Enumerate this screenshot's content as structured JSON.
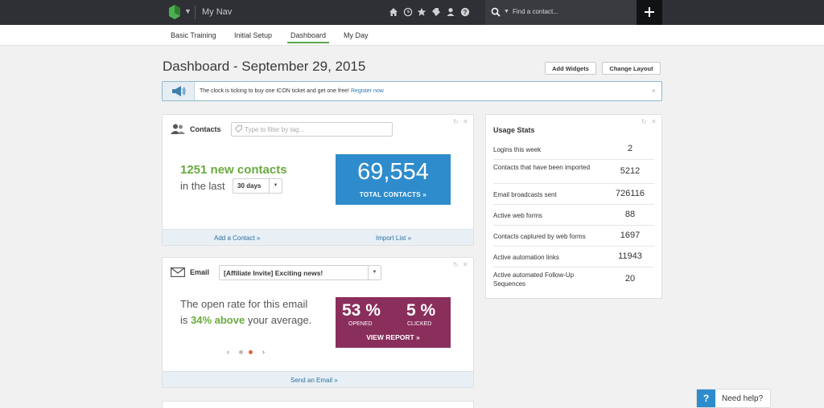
{
  "topbar": {
    "nav_title": "My Nav",
    "icons": [
      "logo-icon",
      "home-icon",
      "clock-icon",
      "star-icon",
      "tags-icon",
      "user-icon",
      "help-icon"
    ],
    "search_placeholder": "Find a contact...",
    "add_symbol": "+"
  },
  "tabs": [
    {
      "label": "Basic Training"
    },
    {
      "label": "Initial Setup"
    },
    {
      "label": "Dashboard",
      "active": true
    },
    {
      "label": "My Day"
    }
  ],
  "header": {
    "title": "Dashboard - September 29, 2015",
    "add_widgets": "Add Widgets",
    "change_layout": "Change Layout"
  },
  "banner": {
    "text": "The clock is ticking to buy one ICON ticket and get one free!",
    "link": "Register now",
    "close": "×"
  },
  "contacts_widget": {
    "title": "Contacts",
    "filter_placeholder": "Type to filter by tag...",
    "new_count_text": "1251 new contacts",
    "in_the_last": "in the last",
    "period": "30 days",
    "total": "69,554",
    "total_label": "TOTAL CONTACTS »",
    "footer_left": "Add a Contact »",
    "footer_right": "Import List »"
  },
  "email_widget": {
    "title": "Email",
    "selected_email": "[Affiliate Invite] Exciting news!",
    "open_text_1": "The open rate for this email is ",
    "open_highlight": "34% above",
    "open_text_2": " your average.",
    "opened_pct": "53 %",
    "opened_label": "OPENED",
    "clicked_pct": "5 %",
    "clicked_label": "CLICKED",
    "view_report": "VIEW REPORT »",
    "pager_prev": "‹",
    "pager_next": "›",
    "footer": "Send an Email »"
  },
  "usage_stats": {
    "title": "Usage Stats",
    "rows": [
      {
        "label": "Logins this week",
        "value": "2"
      },
      {
        "label": "Contacts that have been imported",
        "value": "5212"
      },
      {
        "label": "Email broadcasts sent",
        "value": "726116"
      },
      {
        "label": "Active web forms",
        "value": "88"
      },
      {
        "label": "Contacts captured by web forms",
        "value": "1697"
      },
      {
        "label": "Active automation links",
        "value": "11943"
      },
      {
        "label": "Active automated Follow-Up Sequences",
        "value": "20"
      }
    ]
  },
  "help": {
    "icon": "?",
    "label": "Need help?"
  },
  "colors": {
    "topbar": "#2f3035",
    "accent_green": "#6aaa3e",
    "total_blue": "#2f8ccc",
    "report_purple": "#8a2e5c",
    "link_blue": "#2a6fa3"
  }
}
